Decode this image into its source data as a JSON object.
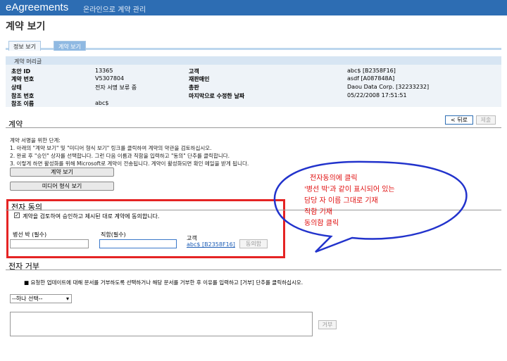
{
  "header": {
    "brand": "eAgreements",
    "subtitle": "온라인으로 계약 관리"
  },
  "page": {
    "title": "계약 보기"
  },
  "tabs": [
    {
      "label": "정보 보기"
    },
    {
      "label": "계약 보기",
      "active": true
    }
  ],
  "summary": {
    "head": "계약 머리글",
    "rows": [
      {
        "l1": "초안 ID",
        "v1": "13365",
        "l2": "고객",
        "v2": "abc$ [B2358F16]"
      },
      {
        "l1": "계약 번호",
        "v1": "V5307804",
        "l2": "재판매인",
        "v2": "asdf [A087848A]"
      },
      {
        "l1": "상태",
        "v1": "전자 서명 보류 중",
        "l2": "총판",
        "v2": "Daou Data Corp. [32233232]"
      },
      {
        "l1": "참조 번호",
        "v1": "",
        "l2": "마지막으로 수정한 날짜",
        "v2": "05/22/2008 17:51:51"
      },
      {
        "l1": "참조 이름",
        "v1": "abc$",
        "l2": "",
        "v2": ""
      }
    ]
  },
  "contract": {
    "heading": "계약",
    "back_label": "< 뒤로",
    "decline_label": "제출",
    "instructions": [
      "계약 서명을 위한 단계:",
      "1. 아래의 \"계약 보기\" 및 \"미디어 형식 보기\" 링크를 클릭하여 계약의 약관을 검토하십시오.",
      "2. 완료 후 \"승인\" 상자를 선택합니다. 그런 다음 이름과 직함을 입력하고 \"동의\" 단추를 클릭합니다.",
      "3. 이렇게 하면 활성화를 위해 Microsoft로 계약이 전송됩니다. 계약이 활성화되면 확인 메일을 받게 됩니다."
    ],
    "view_contract_label": "계약 보기",
    "view_media_label": "미디어 형식 보기"
  },
  "esign": {
    "heading": "전자 동의",
    "checkbox_label": "계약을 검토하여 승인하고 제시된 대로 계약에 동의합니다.",
    "name_label": "병선 박 (필수)",
    "title_label": "직함(필수)",
    "customer_label": "고객",
    "customer_link": "abc$ [B2358F16]",
    "agree_label": "동의함",
    "checked": true
  },
  "reject": {
    "heading": "전자 거부",
    "bullet": "요청한 업데이트에 대해 문서를 거부하도록 선택하거나 해당 문서를 거부한 후 이유를 입력하고 [거부] 단추를 클릭하십시오.",
    "select_value": "--하나 선택--",
    "decline_label": "거부"
  },
  "callout": {
    "lines": [
      "전자동의에 클릭",
      "'병선 박'과 같이 표시되어 있는",
      "담당 자 이름 그대로 기재",
      "직함 기재",
      "동의함 클릭"
    ],
    "color": "#e01010",
    "outline_color": "#2233cc"
  }
}
